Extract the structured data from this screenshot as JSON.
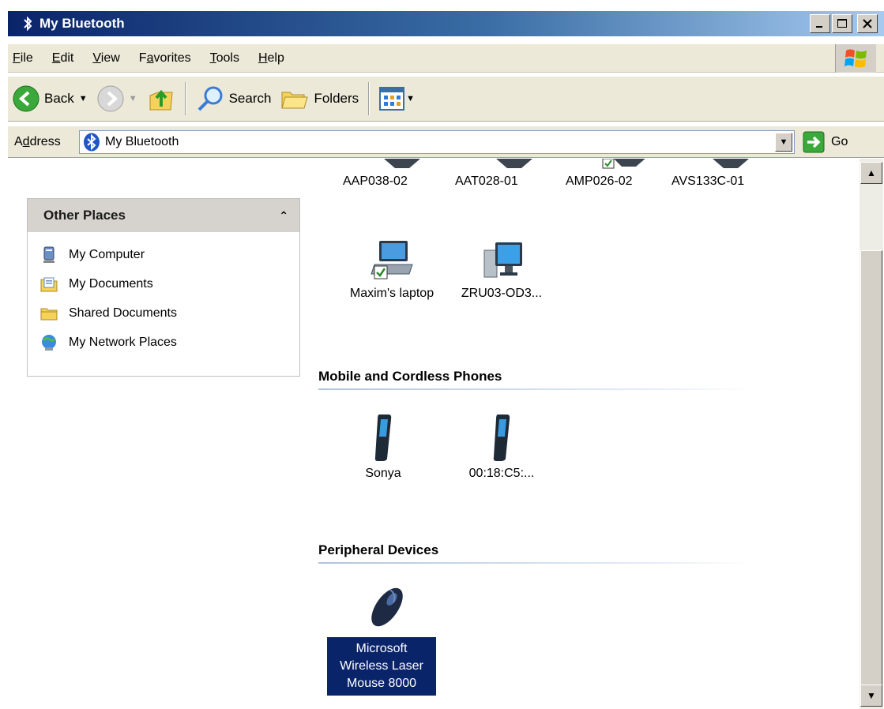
{
  "window": {
    "title": "My Bluetooth",
    "minimize_icon": "minimize-icon",
    "maximize_icon": "maximize-icon",
    "close_icon": "close-icon"
  },
  "menu": [
    {
      "first": "F",
      "rest": "ile"
    },
    {
      "first": "E",
      "rest": "dit"
    },
    {
      "first": "V",
      "rest": "iew"
    },
    {
      "pre": "F",
      "first": "a",
      "rest": "vorites"
    },
    {
      "first": "T",
      "rest": "ools"
    },
    {
      "first": "H",
      "rest": "elp"
    }
  ],
  "toolbar": {
    "back": "Back",
    "search": "Search",
    "folders": "Folders"
  },
  "address": {
    "label_pre": "A",
    "label_ul": "d",
    "label_rest": "dress",
    "value": "My Bluetooth",
    "go": "Go"
  },
  "other_places": {
    "title": "Other Places",
    "items": [
      {
        "label": "My Computer",
        "icon": "computer-icon"
      },
      {
        "label": "My Documents",
        "icon": "documents-icon"
      },
      {
        "label": "Shared Documents",
        "icon": "folder-icon"
      },
      {
        "label": "My Network Places",
        "icon": "network-icon"
      }
    ]
  },
  "devices_top": [
    "AAP038-02",
    "AAT028-01",
    "AMP026-02",
    "AVS133C-01"
  ],
  "computers": [
    "Maxim's laptop",
    "ZRU03-OD3..."
  ],
  "groups": {
    "phones": "Mobile and Cordless Phones",
    "peripherals": "Peripheral Devices"
  },
  "phones": [
    "Sonya",
    "00:18:C5:..."
  ],
  "peripherals": {
    "line1": "Microsoft",
    "line2": "Wireless Laser",
    "line3": "Mouse 8000"
  },
  "colors": {
    "title_bar": "#0a246a",
    "selection": "#0a246a",
    "chrome": "#ece9d8"
  }
}
